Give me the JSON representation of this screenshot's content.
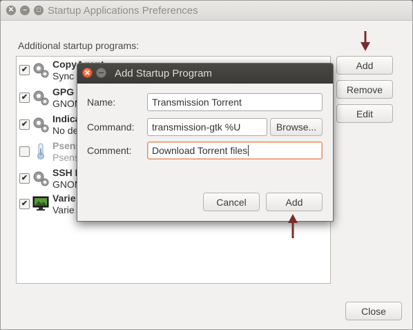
{
  "window": {
    "title": "Startup Applications Preferences",
    "section_label": "Additional startup programs:"
  },
  "programs": [
    {
      "name": "CopyAgent",
      "desc": "Sync f",
      "checked": true,
      "icon": "gear-icon"
    },
    {
      "name": "GPG I",
      "desc": "GNOM",
      "checked": true,
      "icon": "gear-icon"
    },
    {
      "name": "Indica",
      "desc": "No de",
      "checked": true,
      "icon": "gear-icon"
    },
    {
      "name": "Psens",
      "desc": "Psens",
      "checked": false,
      "icon": "thermometer-icon"
    },
    {
      "name": "SSH I",
      "desc": "GNOM",
      "checked": true,
      "icon": "gear-icon"
    },
    {
      "name": "Varie",
      "desc": "Varie",
      "checked": true,
      "icon": "wallpaper-monitor-icon"
    }
  ],
  "buttons": {
    "add": "Add",
    "remove": "Remove",
    "edit": "Edit",
    "close": "Close"
  },
  "dialog": {
    "title": "Add Startup Program",
    "name_label": "Name:",
    "name_value": "Transmission Torrent",
    "command_label": "Command:",
    "command_value": "transmission-gtk %U",
    "browse": "Browse...",
    "comment_label": "Comment:",
    "comment_value": "Download Torrent files",
    "cancel": "Cancel",
    "add": "Add"
  },
  "colors": {
    "annotation_arrow": "#7a2b2b",
    "focus_border": "#e78a61",
    "dialog_titlebar": "#3f3e3a"
  }
}
